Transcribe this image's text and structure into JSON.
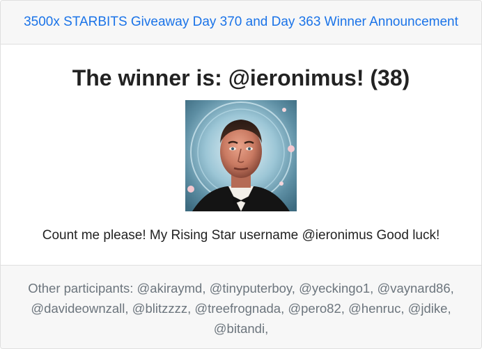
{
  "header": {
    "title": "3500x STARBITS Giveaway Day 370 and Day 363 Winner Announcement"
  },
  "winner": {
    "title": "The winner is: @ieronimus! (38)",
    "image_alt": "winner-portrait",
    "comment": "Count me please! My Rising Star username @ieronimus Good luck!"
  },
  "footer": {
    "participants_text": "Other participants: @akiraymd, @tinyputerboy, @yeckingo1, @vaynard86, @davideownzall, @blitzzzz, @treefrognada, @pero82, @henruc, @jdike, @bitandi,"
  },
  "colors": {
    "link": "#1a73e8",
    "header_bg": "#f7f7f7",
    "muted_text": "#6c757d"
  }
}
